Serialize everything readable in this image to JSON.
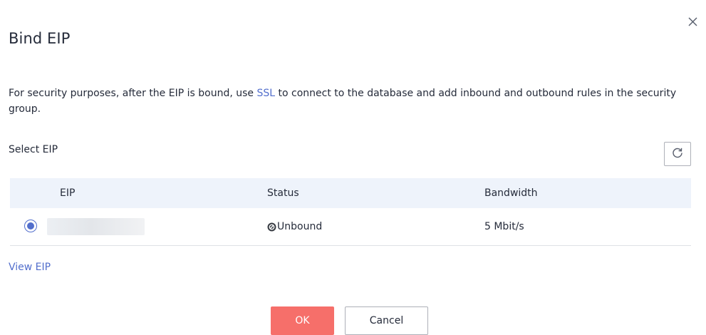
{
  "dialog": {
    "title": "Bind EIP",
    "close_icon": "close-icon"
  },
  "notice": {
    "text_before": "For security purposes, after the EIP is bound, use ",
    "link": "SSL",
    "text_after": " to connect to the database and add inbound and outbound rules in the security group."
  },
  "select": {
    "label": "Select EIP",
    "refresh_icon": "refresh-icon"
  },
  "table": {
    "headers": {
      "eip": "EIP",
      "status": "Status",
      "bandwidth": "Bandwidth"
    },
    "rows": [
      {
        "selected": true,
        "eip": "",
        "status": "Unbound",
        "status_icon": "unbound-icon",
        "bandwidth": "5 Mbit/s"
      }
    ]
  },
  "view_link": "View EIP",
  "buttons": {
    "ok": "OK",
    "cancel": "Cancel"
  },
  "colors": {
    "accent": "#526ecc",
    "primary_button": "#f66f6a",
    "table_header_bg": "#eef3fb"
  }
}
